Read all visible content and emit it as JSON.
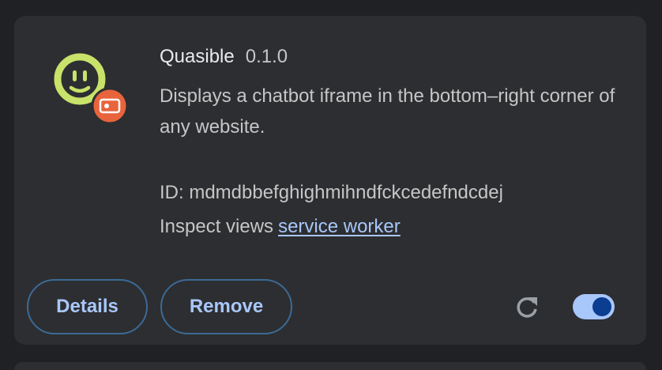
{
  "extension": {
    "name": "Quasible",
    "version": "0.1.0",
    "description": "Displays a chatbot iframe in the bottom–right corner of any website.",
    "id_line": "ID: mdmdbbefghighmihndfckcedefndcdej",
    "inspect_label": "Inspect views",
    "inspect_link": "service worker",
    "enabled": true,
    "icon": "quasible-face-icon",
    "badge_icon": "unpacked-extension-badge-icon"
  },
  "actions": {
    "details_label": "Details",
    "remove_label": "Remove",
    "reload_icon": "reload-icon"
  },
  "colors": {
    "background": "#202124",
    "card": "#2d2e31",
    "accent": "#a8c7fa",
    "icon_green": "#c8e26a",
    "badge_orange": "#e8643c"
  }
}
